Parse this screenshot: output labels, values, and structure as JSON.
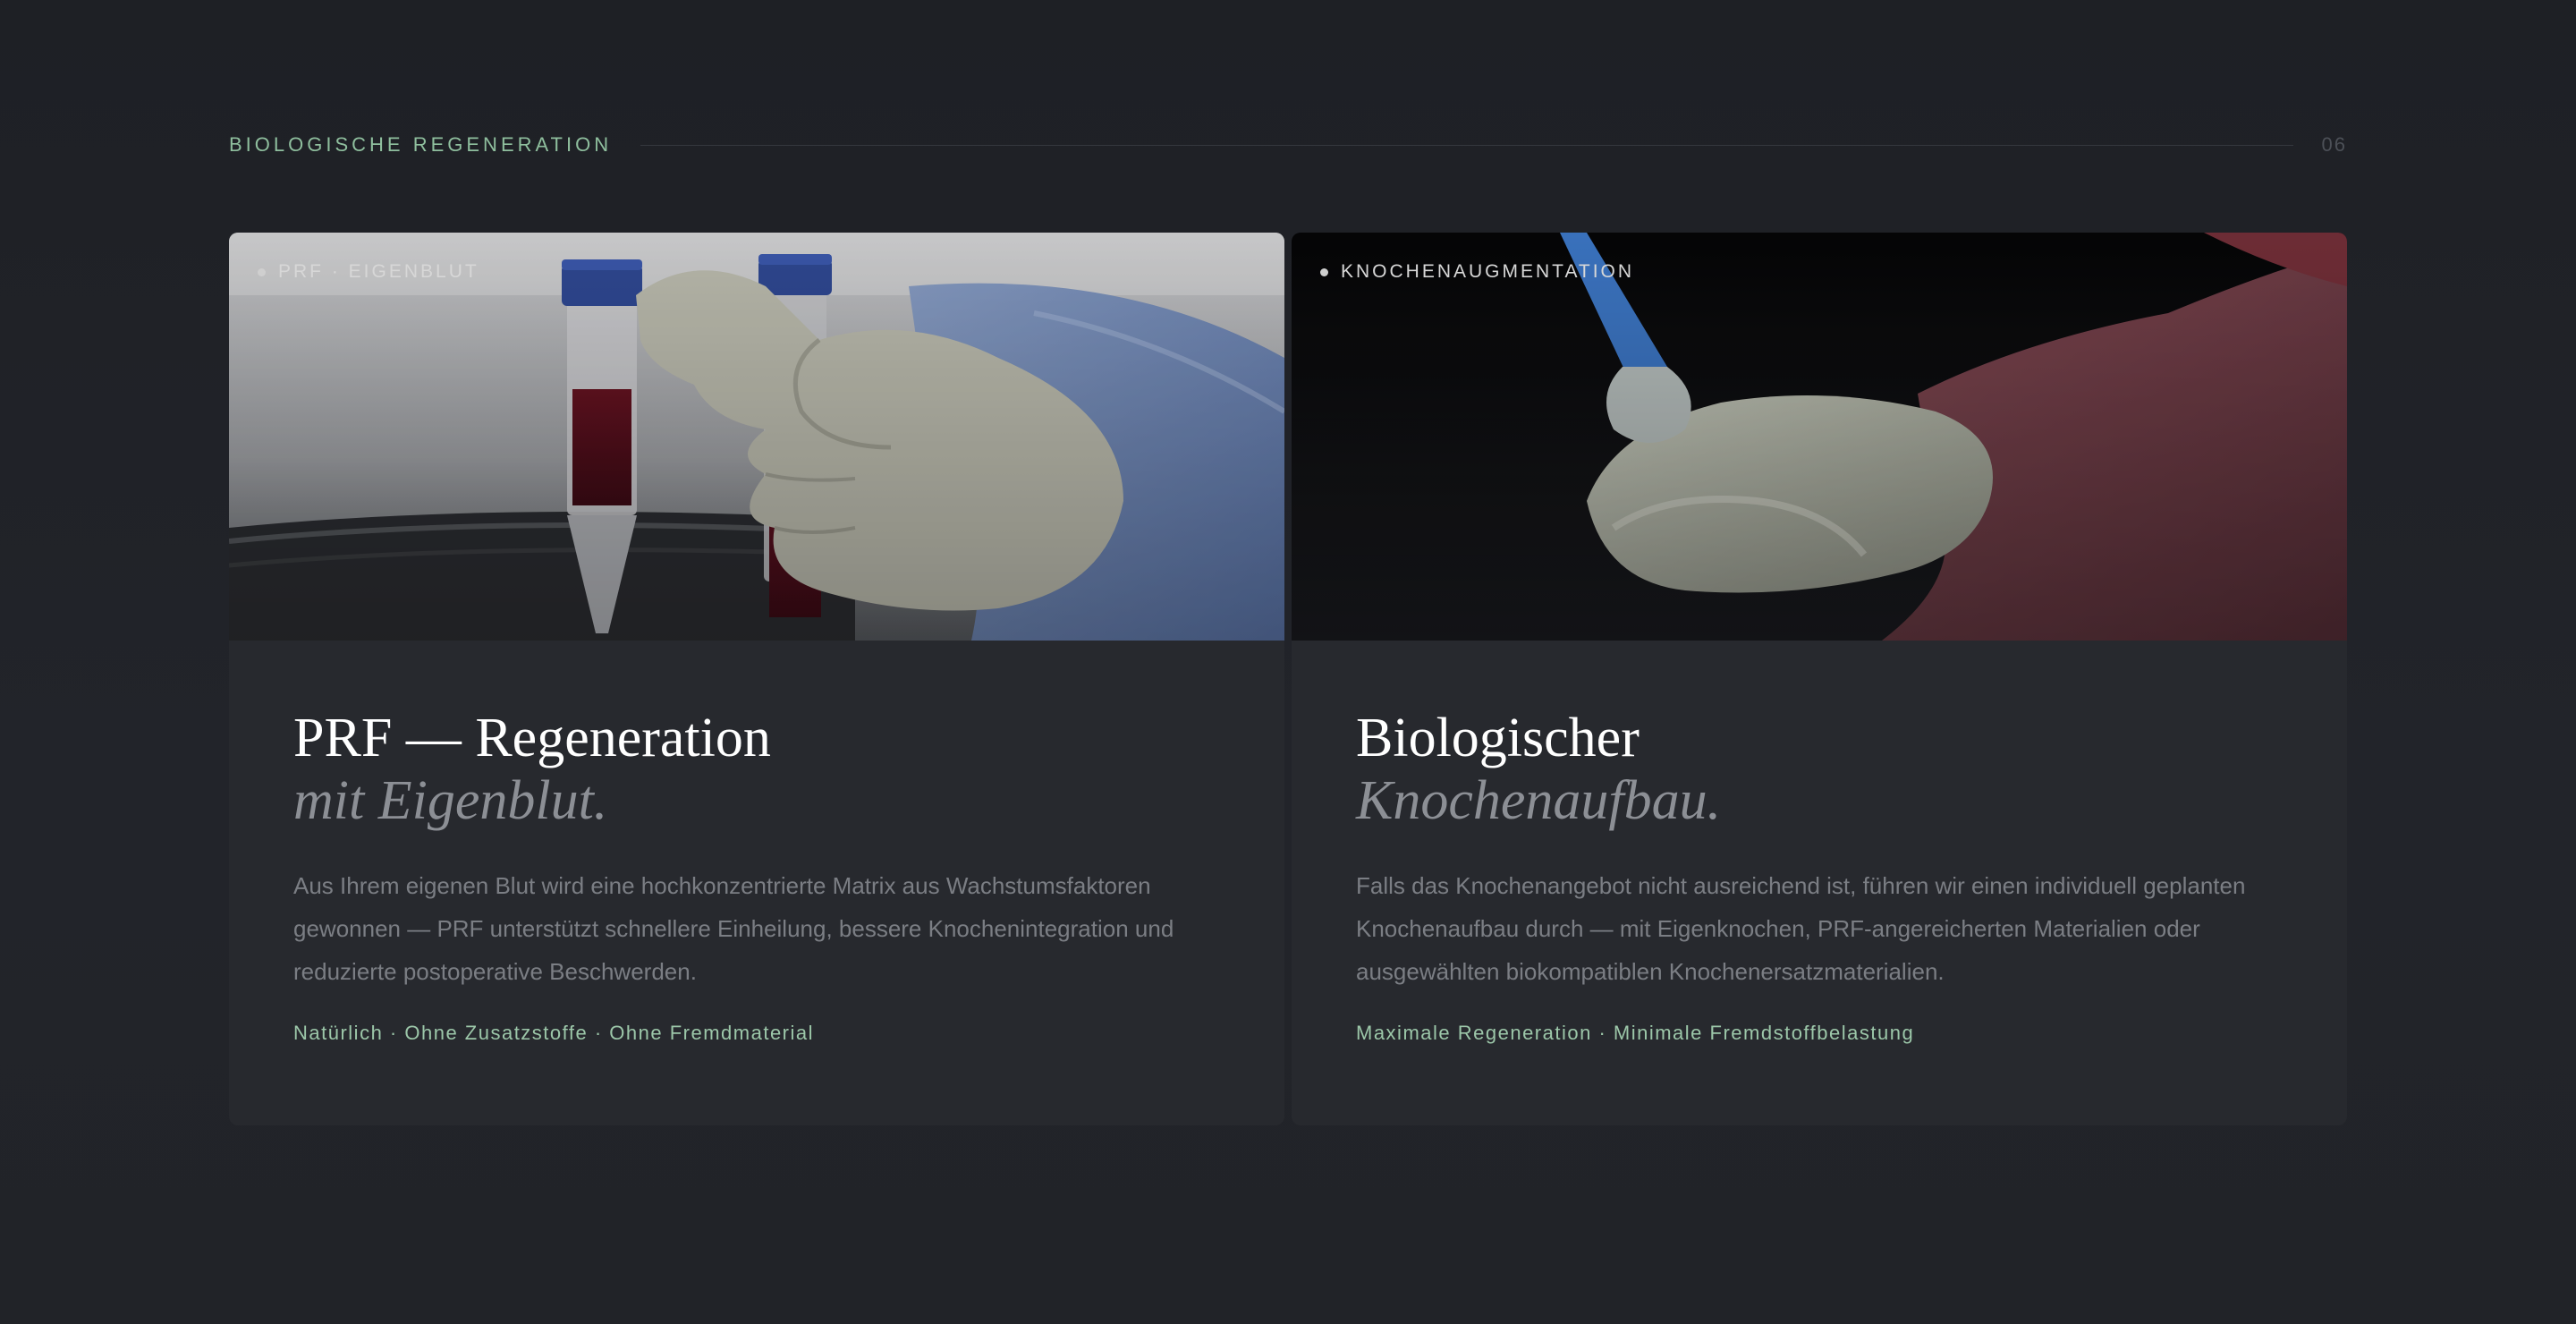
{
  "section": {
    "title": "BIOLOGISCHE REGENERATION",
    "number": "06"
  },
  "cards": [
    {
      "tag": "PRF · EIGENBLUT",
      "title": "PRF — Regeneration",
      "title_em": "mit Eigenblut.",
      "text": "Aus Ihrem eigenen Blut wird eine hochkonzentrierte Matrix aus Wachstumsfaktoren gewonnen — PRF unterstützt schnellere Einheilung, bessere Knochenintegration und reduzierte postoperative Beschwerden.",
      "tags": "Natürlich · Ohne Zusatzstoffe · Ohne Fremdmaterial"
    },
    {
      "tag": "KNOCHENAUGMENTATION",
      "title": "Biologischer",
      "title_em": "Knochenaufbau.",
      "text": "Falls das Knochenangebot nicht ausreichend ist, führen wir einen individuell geplanten Knochenaufbau durch — mit Eigenknochen, PRF-angereicherten Materialien oder ausgewählten biokompatiblen Knochenersatzmaterialien.",
      "tags": "Maximale Regeneration · Minimale Fremdstoffbelastung"
    }
  ],
  "colors": {
    "background": "#1f2126",
    "card": "#27292e",
    "accent": "#8fbf9e",
    "title": "#ffffff",
    "muted": "#7b7e84"
  }
}
